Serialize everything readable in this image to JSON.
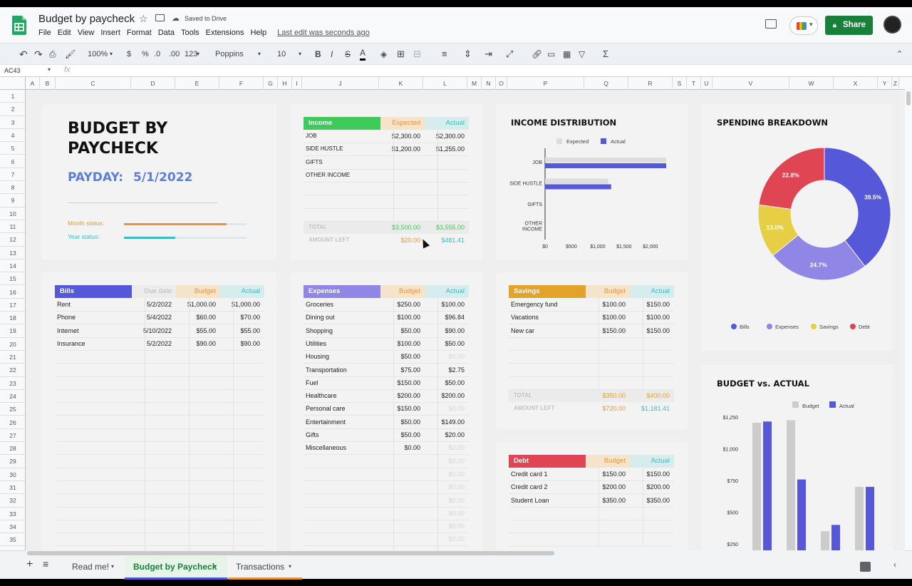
{
  "doc": {
    "title": "Budget by paycheck",
    "saved": "Saved to Drive",
    "last_edit": "Last edit was seconds ago",
    "share": "Share"
  },
  "menu": [
    "File",
    "Edit",
    "View",
    "Insert",
    "Format",
    "Data",
    "Tools",
    "Extensions",
    "Help"
  ],
  "toolbar": {
    "zoom": "100%",
    "currency": "$",
    "percent": "%",
    "dec_less": ".0",
    "dec_more": ".00",
    "format_more": "123",
    "font": "Poppins",
    "font_size": "10"
  },
  "namebox": "AC43",
  "fx": "fx",
  "columns": [
    "A",
    "B",
    "C",
    "D",
    "E",
    "F",
    "G",
    "H",
    "I",
    "J",
    "K",
    "L",
    "M",
    "N",
    "O",
    "P",
    "Q",
    "R",
    "S",
    "T",
    "U",
    "V",
    "W",
    "X",
    "Y",
    "Z"
  ],
  "rows": [
    "1",
    "2",
    "3",
    "4",
    "5",
    "6",
    "7",
    "8",
    "9",
    "10",
    "11",
    "12",
    "13",
    "14",
    "15",
    "16",
    "17",
    "18",
    "19",
    "20",
    "21",
    "22",
    "23",
    "24",
    "25",
    "26",
    "27",
    "28",
    "29",
    "30",
    "31",
    "32",
    "33",
    "34",
    "35"
  ],
  "header": {
    "title_line1": "BUDGET BY",
    "title_line2": "PAYCHECK",
    "payday_label": "PAYDAY:",
    "payday_date": "5/1/2022",
    "month_status": "Month status:",
    "year_status": "Year status:",
    "month_progress": 0.84,
    "year_progress": 0.42
  },
  "income": {
    "header": [
      "Income",
      "Expected",
      "Actual"
    ],
    "rows": [
      [
        "JOB",
        "$2,300.00",
        "$2,300.00"
      ],
      [
        "SIDE HUSTLE",
        "$1,200.00",
        "$1,255.00"
      ],
      [
        "GIFTS",
        "",
        ""
      ],
      [
        "OTHER INCOME",
        "",
        ""
      ]
    ],
    "total": [
      "TOTAL",
      "$3,500.00",
      "$3,555.00"
    ],
    "left": [
      "AMOUNT LEFT",
      "$20.00",
      "$481.41"
    ]
  },
  "bills": {
    "header": [
      "Bills",
      "Due date",
      "Budget",
      "Actual"
    ],
    "rows": [
      [
        "Rent",
        "5/2/2022",
        "$1,000.00",
        "$1,000.00"
      ],
      [
        "Phone",
        "5/4/2022",
        "$60.00",
        "$70.00"
      ],
      [
        "Internet",
        "5/10/2022",
        "$55.00",
        "$55.00"
      ],
      [
        "Insurance",
        "5/2/2022",
        "$90.00",
        "$90.00"
      ]
    ]
  },
  "expenses": {
    "header": [
      "Expenses",
      "Budget",
      "Actual"
    ],
    "rows": [
      [
        "Groceries",
        "$250.00",
        "$100.00"
      ],
      [
        "Dining out",
        "$100.00",
        "$96.84"
      ],
      [
        "Shopping",
        "$50.00",
        "$90.00"
      ],
      [
        "Utilities",
        "$100.00",
        "$50.00"
      ],
      [
        "Housing",
        "$50.00",
        "$0.00"
      ],
      [
        "Transportation",
        "$75.00",
        "$2.75"
      ],
      [
        "Fuel",
        "$150.00",
        "$50.00"
      ],
      [
        "Healthcare",
        "$200.00",
        "$200.00"
      ],
      [
        "Personal care",
        "$150.00",
        "$0.00"
      ],
      [
        "Entertainment",
        "$50.00",
        "$149.00"
      ],
      [
        "Gifts",
        "$50.00",
        "$20.00"
      ],
      [
        "Miscellaneous",
        "$0.00",
        "$0.00"
      ]
    ],
    "filler": [
      "$0.00",
      "$0.00",
      "$0.00",
      "$0.00",
      "$0.00",
      "$0.00",
      "$0.00"
    ]
  },
  "savings": {
    "header": [
      "Savings",
      "Budget",
      "Actual"
    ],
    "rows": [
      [
        "Emergency fund",
        "$100.00",
        "$150.00"
      ],
      [
        "Vacations",
        "$100.00",
        "$100.00"
      ],
      [
        "New car",
        "$150.00",
        "$150.00"
      ]
    ],
    "total": [
      "TOTAL",
      "$350.00",
      "$400.00"
    ],
    "left": [
      "AMOUNT LEFT",
      "$720.00",
      "$1,181.41"
    ]
  },
  "debt": {
    "header": [
      "Debt",
      "Budget",
      "Actual"
    ],
    "rows": [
      [
        "Credit card 1",
        "$150.00",
        "$150.00"
      ],
      [
        "Credit card 2",
        "$200.00",
        "$200.00"
      ],
      [
        "Student Loan",
        "$350.00",
        "$350.00"
      ]
    ]
  },
  "colors": {
    "green": "#3ecb5b",
    "orange": "#e8963b",
    "teal": "#3bbcc4",
    "bills": "#5558d9",
    "expenses": "#8f86e6",
    "savings": "#e3a22a",
    "debt": "#e04553",
    "payday": "#5b7fd6",
    "share": "#188038"
  },
  "chart_data": [
    {
      "type": "bar",
      "orientation": "horizontal",
      "title": "INCOME DISTRIBUTION",
      "categories": [
        "JOB",
        "SIDE HUSTLE",
        "GIFTS",
        "OTHER INCOME"
      ],
      "series": [
        {
          "name": "Expected",
          "values": [
            2300,
            1200,
            0,
            0
          ],
          "color": "#dddddd"
        },
        {
          "name": "Actual",
          "values": [
            2300,
            1255,
            0,
            0
          ],
          "color": "#5558d9"
        }
      ],
      "xticks": [
        "$0",
        "$500",
        "$1,000",
        "$1,500",
        "$2,000"
      ],
      "xlim": [
        0,
        2300
      ],
      "legend": "top"
    },
    {
      "type": "pie",
      "title": "SPENDING BREAKDOWN",
      "labels": [
        "Bills",
        "Expenses",
        "Savings",
        "Debt"
      ],
      "values": [
        39.5,
        24.7,
        13.0,
        22.8
      ],
      "value_labels": [
        "39.5%",
        "24.7%",
        "13.0%",
        "22.8%"
      ],
      "colors": [
        "#5558d9",
        "#8f86e6",
        "#e6cf45",
        "#e04553"
      ],
      "legend": "bottom"
    },
    {
      "type": "bar",
      "title": "BUDGET vs. ACTUAL",
      "categories": [
        "Bills",
        "Expenses",
        "Savings",
        "Debt"
      ],
      "series": [
        {
          "name": "Budget",
          "values": [
            1205,
            1225,
            350,
            700
          ],
          "color": "#cccccc"
        },
        {
          "name": "Actual",
          "values": [
            1215,
            758,
            400,
            700
          ],
          "color": "#5558d9"
        }
      ],
      "yticks": [
        "$1,250",
        "$1,000",
        "$750",
        "$500",
        "$250"
      ],
      "ylim": [
        250,
        1250
      ],
      "legend": "top"
    }
  ],
  "sheets": {
    "tabs": [
      "Read me!",
      "Budget by Paycheck",
      "Transactions"
    ],
    "active": "Budget by Paycheck"
  }
}
